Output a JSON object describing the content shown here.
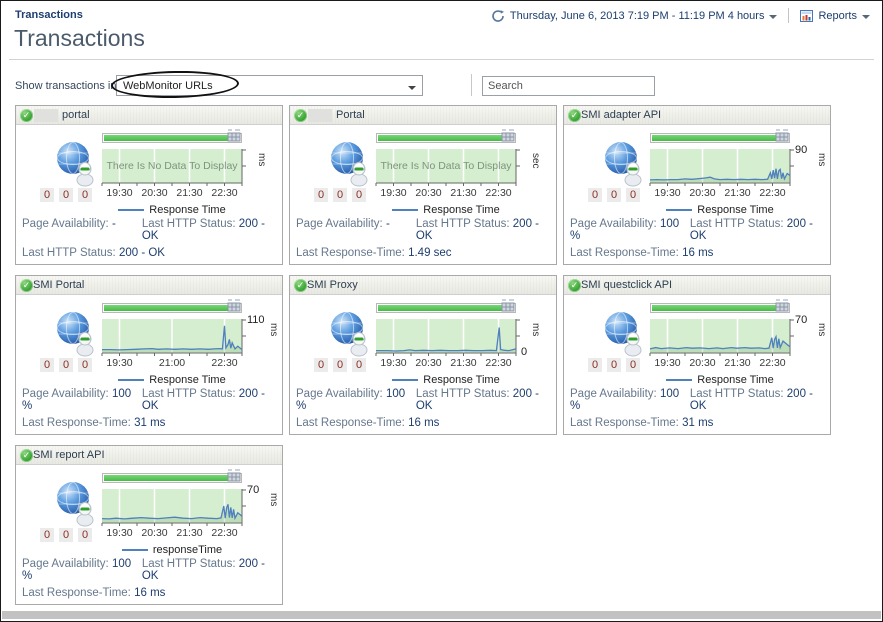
{
  "colors": {
    "line": "#4f81bd",
    "plot_bg": "#d5eecf",
    "bar_green": "#46ba46",
    "ok_green": "#2f9e2a",
    "value_text": "#1d3e6e",
    "label_text": "#66788c"
  },
  "header": {
    "breadcrumb": "Transactions",
    "title": "Transactions",
    "time_range": "Thursday, June 6, 2013 7:19 PM - 11:19 PM 4 hours",
    "time_icon": "zonar-clock-icon",
    "reports_label": "Reports",
    "reports_icon": "bar-chart-report-icon"
  },
  "filter": {
    "label": "Show transactions in",
    "selected_option": "WebMonitor URLs",
    "search_placeholder": "Search",
    "annotation": "hand-drawn-ellipse-around-selected-option"
  },
  "cards": [
    {
      "title": "portal",
      "redacted": true,
      "status": "ok",
      "counters": [
        "0",
        "0",
        "0"
      ],
      "chart": {
        "type": "line",
        "unit": "ms",
        "ymax": "",
        "y0": "",
        "no_data": true,
        "no_data_text": "There Is No Data To Display",
        "legend": "Response Time",
        "xticks": [
          "19:30",
          "20:30",
          "21:30",
          "22:30"
        ],
        "tick_fractions": [
          0.125,
          0.375,
          0.625,
          0.875
        ],
        "points": []
      },
      "stats": {
        "row1_left_label": "Page Availability:",
        "row1_left_value": "-",
        "row1_right_label": "Last HTTP Status:",
        "row1_right_value": "200 - OK",
        "row2_label": "Last HTTP Status:",
        "row2_value": "200 - OK"
      }
    },
    {
      "title": "Portal",
      "redacted": true,
      "status": "ok",
      "counters": [
        "0",
        "0",
        "0"
      ],
      "chart": {
        "type": "line",
        "unit": "sec",
        "ymax": "",
        "y0": "",
        "no_data": true,
        "no_data_text": "There Is No Data To Display",
        "legend": "Response Time",
        "xticks": [
          "19:30",
          "20:30",
          "21:30",
          "22:30"
        ],
        "tick_fractions": [
          0.125,
          0.375,
          0.625,
          0.875
        ],
        "points": []
      },
      "stats": {
        "row1_left_label": "Page Availability:",
        "row1_left_value": "-",
        "row1_right_label": "Last HTTP Status:",
        "row1_right_value": "200 - OK",
        "row2_label": "Last Response-Time:",
        "row2_value": "1.49 sec"
      }
    },
    {
      "title": "SMI adapter API",
      "redacted": false,
      "status": "ok",
      "counters": [
        "0",
        "0",
        "0"
      ],
      "chart": {
        "type": "line",
        "unit": "ms",
        "ymax": "90",
        "y0": "",
        "no_data": false,
        "legend": "Response Time",
        "xticks": [
          "19:30",
          "20:30",
          "21:30",
          "22:30"
        ],
        "tick_fractions": [
          0.125,
          0.375,
          0.625,
          0.875
        ],
        "points": [
          [
            0,
            0.09
          ],
          [
            0.05,
            0.1
          ],
          [
            0.1,
            0.09
          ],
          [
            0.15,
            0.1
          ],
          [
            0.2,
            0.1
          ],
          [
            0.25,
            0.12
          ],
          [
            0.3,
            0.11
          ],
          [
            0.35,
            0.13
          ],
          [
            0.4,
            0.15
          ],
          [
            0.43,
            0.17
          ],
          [
            0.46,
            0.12
          ],
          [
            0.5,
            0.1
          ],
          [
            0.55,
            0.11
          ],
          [
            0.6,
            0.1
          ],
          [
            0.65,
            0.11
          ],
          [
            0.7,
            0.1
          ],
          [
            0.75,
            0.11
          ],
          [
            0.8,
            0.1
          ],
          [
            0.84,
            0.11
          ],
          [
            0.86,
            0.3
          ],
          [
            0.87,
            0.12
          ],
          [
            0.88,
            0.38
          ],
          [
            0.89,
            0.14
          ],
          [
            0.9,
            0.42
          ],
          [
            0.91,
            0.12
          ],
          [
            0.92,
            0.36
          ],
          [
            0.93,
            0.4
          ],
          [
            0.94,
            0.13
          ],
          [
            0.95,
            0.3
          ],
          [
            0.96,
            0.12
          ],
          [
            0.98,
            0.28
          ],
          [
            1,
            0.22
          ]
        ]
      },
      "stats": {
        "row1_left_label": "Page Availability:",
        "row1_left_value": "100 %",
        "row1_right_label": "Last HTTP Status:",
        "row1_right_value": "200 - OK",
        "row2_label": "Last Response-Time:",
        "row2_value": "16 ms"
      }
    },
    {
      "title": "SMI Portal",
      "redacted": false,
      "status": "ok",
      "counters": [
        "0",
        "0",
        "0"
      ],
      "chart": {
        "type": "line",
        "unit": "ms",
        "ymax": "110",
        "y0": "",
        "no_data": false,
        "legend": "Response Time",
        "xticks": [
          "19:30",
          "21:00",
          "22:30"
        ],
        "tick_fractions": [
          0.125,
          0.5,
          0.875
        ],
        "points": [
          [
            0,
            0.1
          ],
          [
            0.06,
            0.1
          ],
          [
            0.12,
            0.09
          ],
          [
            0.18,
            0.1
          ],
          [
            0.24,
            0.11
          ],
          [
            0.3,
            0.12
          ],
          [
            0.36,
            0.13
          ],
          [
            0.4,
            0.11
          ],
          [
            0.46,
            0.12
          ],
          [
            0.52,
            0.11
          ],
          [
            0.58,
            0.12
          ],
          [
            0.64,
            0.11
          ],
          [
            0.7,
            0.12
          ],
          [
            0.76,
            0.11
          ],
          [
            0.8,
            0.12
          ],
          [
            0.84,
            0.13
          ],
          [
            0.86,
            0.12
          ],
          [
            0.875,
            0.8
          ],
          [
            0.885,
            0.15
          ],
          [
            0.9,
            0.25
          ],
          [
            0.91,
            0.4
          ],
          [
            0.92,
            0.14
          ],
          [
            0.93,
            0.3
          ],
          [
            0.95,
            0.12
          ],
          [
            0.97,
            0.2
          ],
          [
            1,
            0.1
          ]
        ]
      },
      "stats": {
        "row1_left_label": "Page Availability:",
        "row1_left_value": "100 %",
        "row1_right_label": "Last HTTP Status:",
        "row1_right_value": "200 - OK",
        "row2_label": "Last Response-Time:",
        "row2_value": "31 ms"
      }
    },
    {
      "title": "SMI Proxy",
      "redacted": false,
      "status": "ok",
      "counters": [
        "0",
        "0",
        "0"
      ],
      "chart": {
        "type": "line",
        "unit": "ms",
        "ymax": "",
        "y0": "0",
        "no_data": false,
        "legend": "Response Time",
        "xticks": [
          "19:30",
          "20:30",
          "21:30",
          "22:30"
        ],
        "tick_fractions": [
          0.125,
          0.375,
          0.625,
          0.875
        ],
        "points": [
          [
            0,
            0.07
          ],
          [
            0.08,
            0.07
          ],
          [
            0.14,
            0.06
          ],
          [
            0.2,
            0.07
          ],
          [
            0.24,
            0.09
          ],
          [
            0.28,
            0.07
          ],
          [
            0.34,
            0.08
          ],
          [
            0.4,
            0.07
          ],
          [
            0.46,
            0.08
          ],
          [
            0.52,
            0.07
          ],
          [
            0.58,
            0.07
          ],
          [
            0.64,
            0.08
          ],
          [
            0.7,
            0.07
          ],
          [
            0.76,
            0.07
          ],
          [
            0.82,
            0.08
          ],
          [
            0.86,
            0.07
          ],
          [
            0.88,
            0.75
          ],
          [
            0.89,
            0.1
          ],
          [
            0.92,
            0.08
          ],
          [
            0.95,
            0.07
          ],
          [
            1,
            0.12
          ]
        ]
      },
      "stats": {
        "row1_left_label": "Page Availability:",
        "row1_left_value": "100 %",
        "row1_right_label": "Last HTTP Status:",
        "row1_right_value": "200 - OK",
        "row2_label": "Last Response-Time:",
        "row2_value": "16 ms"
      }
    },
    {
      "title": "SMI questclick API",
      "redacted": false,
      "status": "ok",
      "counters": [
        "0",
        "0",
        "0"
      ],
      "chart": {
        "type": "line",
        "unit": "ms",
        "ymax": "70",
        "y0": "",
        "no_data": false,
        "legend": "Response Time",
        "xticks": [
          "19:30",
          "20:30",
          "21:30",
          "22:30"
        ],
        "tick_fractions": [
          0.125,
          0.375,
          0.625,
          0.875
        ],
        "points": [
          [
            0,
            0.12
          ],
          [
            0.04,
            0.16
          ],
          [
            0.08,
            0.13
          ],
          [
            0.14,
            0.15
          ],
          [
            0.2,
            0.13
          ],
          [
            0.26,
            0.16
          ],
          [
            0.3,
            0.14
          ],
          [
            0.36,
            0.15
          ],
          [
            0.42,
            0.13
          ],
          [
            0.48,
            0.15
          ],
          [
            0.52,
            0.13
          ],
          [
            0.58,
            0.16
          ],
          [
            0.62,
            0.14
          ],
          [
            0.68,
            0.16
          ],
          [
            0.72,
            0.14
          ],
          [
            0.78,
            0.15
          ],
          [
            0.82,
            0.13
          ],
          [
            0.85,
            0.14
          ],
          [
            0.87,
            0.45
          ],
          [
            0.88,
            0.14
          ],
          [
            0.89,
            0.4
          ],
          [
            0.9,
            0.48
          ],
          [
            0.91,
            0.15
          ],
          [
            0.92,
            0.42
          ],
          [
            0.93,
            0.16
          ],
          [
            0.95,
            0.35
          ],
          [
            1,
            0.18
          ]
        ]
      },
      "stats": {
        "row1_left_label": "Page Availability:",
        "row1_left_value": "100 %",
        "row1_right_label": "Last HTTP Status:",
        "row1_right_value": "200 - OK",
        "row2_label": "Last Response-Time:",
        "row2_value": "31 ms"
      }
    },
    {
      "title": "SMI report API",
      "redacted": false,
      "status": "ok",
      "counters": [
        "0",
        "0",
        "0"
      ],
      "chart": {
        "type": "line",
        "unit": "ms",
        "ymax": "70",
        "y0": "",
        "no_data": false,
        "legend": "responseTime",
        "xticks": [
          "19:30",
          "20:30",
          "21:30",
          "22:30"
        ],
        "tick_fractions": [
          0.125,
          0.375,
          0.625,
          0.875
        ],
        "points": [
          [
            0,
            0.13
          ],
          [
            0.05,
            0.12
          ],
          [
            0.1,
            0.14
          ],
          [
            0.16,
            0.12
          ],
          [
            0.22,
            0.14
          ],
          [
            0.28,
            0.16
          ],
          [
            0.34,
            0.14
          ],
          [
            0.4,
            0.13
          ],
          [
            0.46,
            0.15
          ],
          [
            0.52,
            0.17
          ],
          [
            0.58,
            0.14
          ],
          [
            0.64,
            0.13
          ],
          [
            0.7,
            0.16
          ],
          [
            0.76,
            0.14
          ],
          [
            0.82,
            0.13
          ],
          [
            0.85,
            0.15
          ],
          [
            0.87,
            0.5
          ],
          [
            0.88,
            0.14
          ],
          [
            0.89,
            0.44
          ],
          [
            0.9,
            0.55
          ],
          [
            0.91,
            0.16
          ],
          [
            0.92,
            0.46
          ],
          [
            0.93,
            0.15
          ],
          [
            0.94,
            0.4
          ],
          [
            0.95,
            0.14
          ],
          [
            0.97,
            0.3
          ],
          [
            1,
            0.2
          ]
        ]
      },
      "stats": {
        "row1_left_label": "Page Availability:",
        "row1_left_value": "100 %",
        "row1_right_label": "Last HTTP Status:",
        "row1_right_value": "200 - OK",
        "row2_label": "Last Response-Time:",
        "row2_value": "16 ms"
      }
    }
  ]
}
